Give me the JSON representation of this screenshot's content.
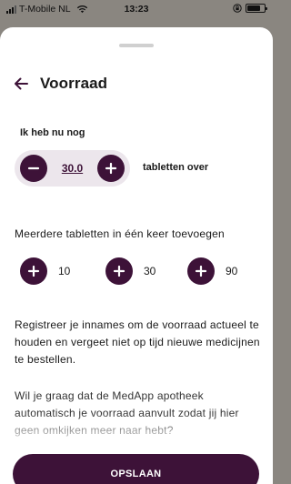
{
  "status_bar": {
    "carrier": "T-Mobile NL",
    "time": "13:23"
  },
  "header": {
    "back_icon": "arrow-left-icon",
    "title": "Voorraad"
  },
  "stock": {
    "label": "Ik heb nu nog",
    "value": "30.0",
    "unit_label": "tabletten over"
  },
  "multi_add": {
    "label": "Meerdere tabletten in één keer toevoegen",
    "options": [
      "10",
      "30",
      "90"
    ]
  },
  "info_text": "Registreer je innames om de voorraad actueel te houden en vergeet niet op tijd nieuwe medicijnen te bestellen.",
  "question_text": "Wil je graag dat de MedApp apotheek automatisch je voorraad aanvult zodat jij hier geen omkijken meer naar hebt?",
  "save_button": {
    "label": "OPSLAAN"
  },
  "colors": {
    "primary": "#3d1238",
    "stepper_bg": "#ece6ec",
    "backdrop": "#8a8680"
  }
}
